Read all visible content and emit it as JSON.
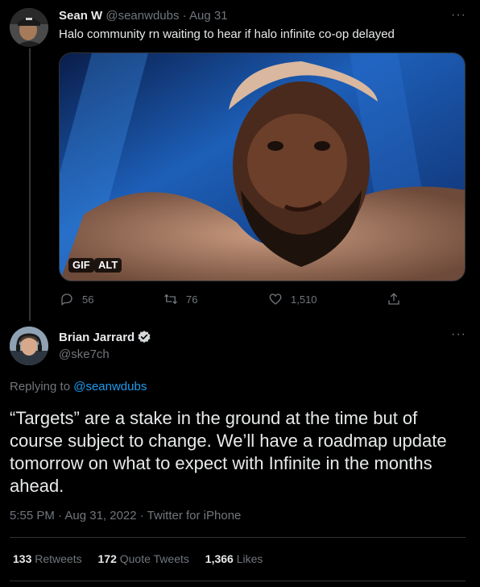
{
  "parent_tweet": {
    "author_name": "Sean W",
    "author_handle": "@seanwdubs",
    "date": "· Aug 31",
    "text": "Halo community rn waiting to hear if halo infinite co-op delayed",
    "more_icon": "···",
    "media": {
      "badges": [
        "GIF",
        "ALT"
      ]
    },
    "actions": {
      "replies": "56",
      "retweets": "76",
      "likes": "1,510"
    }
  },
  "main_tweet": {
    "author_name": "Brian Jarrard",
    "author_handle": "@ske7ch",
    "verified": true,
    "more_icon": "···",
    "reply_prefix": "Replying to",
    "reply_to": "@seanwdubs",
    "text": "“Targets” are a stake in the ground at the time but of course subject to change. We’ll have a roadmap update tomorrow on what to expect with Infinite in the months ahead.",
    "timestamp": "5:55 PM · Aug 31, 2022 · Twitter for iPhone",
    "stats": {
      "retweets_count": "133",
      "retweets_label": "Retweets",
      "quotes_count": "172",
      "quotes_label": "Quote Tweets",
      "likes_count": "1,366",
      "likes_label": "Likes"
    }
  },
  "colors": {
    "background": "#000000",
    "text": "#e7e9ea",
    "muted": "#71767b",
    "link": "#1d9bf0",
    "verified": "#d6d9db",
    "divider": "#2f3336"
  }
}
